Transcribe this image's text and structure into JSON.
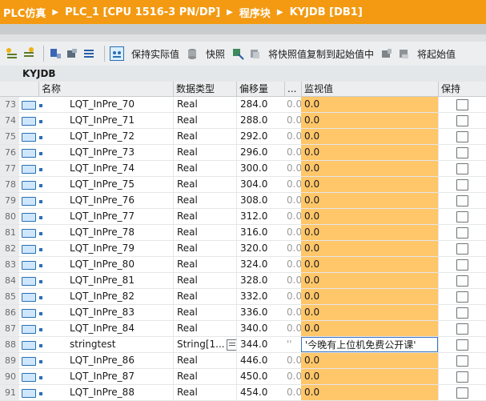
{
  "breadcrumb": [
    "PLC仿真",
    "PLC_1 [CPU 1516-3 PN/DP]",
    "程序块",
    "KYJDB [DB1]"
  ],
  "toolbar": {
    "keep_actual": "保持实际值",
    "snapshot": "快照",
    "copy_snapshot": "将快照值复制到起始值中",
    "load_start": "将起始值"
  },
  "db_title": "KYJDB",
  "columns": {
    "name": "名称",
    "type": "数据类型",
    "offset": "偏移量",
    "start": "...",
    "monitor": "监视值",
    "keep": "保持"
  },
  "rows": [
    {
      "n": "73",
      "name": "LQT_InPre_70",
      "type": "Real",
      "offset": "284.0",
      "start": "0.0",
      "monitor": "0.0"
    },
    {
      "n": "74",
      "name": "LQT_InPre_71",
      "type": "Real",
      "offset": "288.0",
      "start": "0.0",
      "monitor": "0.0"
    },
    {
      "n": "75",
      "name": "LQT_InPre_72",
      "type": "Real",
      "offset": "292.0",
      "start": "0.0",
      "monitor": "0.0"
    },
    {
      "n": "76",
      "name": "LQT_InPre_73",
      "type": "Real",
      "offset": "296.0",
      "start": "0.0",
      "monitor": "0.0"
    },
    {
      "n": "77",
      "name": "LQT_InPre_74",
      "type": "Real",
      "offset": "300.0",
      "start": "0.0",
      "monitor": "0.0"
    },
    {
      "n": "78",
      "name": "LQT_InPre_75",
      "type": "Real",
      "offset": "304.0",
      "start": "0.0",
      "monitor": "0.0"
    },
    {
      "n": "79",
      "name": "LQT_InPre_76",
      "type": "Real",
      "offset": "308.0",
      "start": "0.0",
      "monitor": "0.0"
    },
    {
      "n": "80",
      "name": "LQT_InPre_77",
      "type": "Real",
      "offset": "312.0",
      "start": "0.0",
      "monitor": "0.0"
    },
    {
      "n": "81",
      "name": "LQT_InPre_78",
      "type": "Real",
      "offset": "316.0",
      "start": "0.0",
      "monitor": "0.0"
    },
    {
      "n": "82",
      "name": "LQT_InPre_79",
      "type": "Real",
      "offset": "320.0",
      "start": "0.0",
      "monitor": "0.0"
    },
    {
      "n": "83",
      "name": "LQT_InPre_80",
      "type": "Real",
      "offset": "324.0",
      "start": "0.0",
      "monitor": "0.0"
    },
    {
      "n": "84",
      "name": "LQT_InPre_81",
      "type": "Real",
      "offset": "328.0",
      "start": "0.0",
      "monitor": "0.0"
    },
    {
      "n": "85",
      "name": "LQT_InPre_82",
      "type": "Real",
      "offset": "332.0",
      "start": "0.0",
      "monitor": "0.0"
    },
    {
      "n": "86",
      "name": "LQT_InPre_83",
      "type": "Real",
      "offset": "336.0",
      "start": "0.0",
      "monitor": "0.0"
    },
    {
      "n": "87",
      "name": "LQT_InPre_84",
      "type": "Real",
      "offset": "340.0",
      "start": "0.0",
      "monitor": "0.0"
    },
    {
      "n": "88",
      "name": "stringtest",
      "type": "String[1...",
      "offset": "344.0",
      "start": "''",
      "monitor": "'今晚有上位机免费公开课'"
    },
    {
      "n": "89",
      "name": "LQT_InPre_86",
      "type": "Real",
      "offset": "446.0",
      "start": "0.0",
      "monitor": "0.0"
    },
    {
      "n": "90",
      "name": "LQT_InPre_87",
      "type": "Real",
      "offset": "450.0",
      "start": "0.0",
      "monitor": "0.0"
    },
    {
      "n": "91",
      "name": "LQT_InPre_88",
      "type": "Real",
      "offset": "454.0",
      "start": "0.0",
      "monitor": "0.0"
    }
  ]
}
